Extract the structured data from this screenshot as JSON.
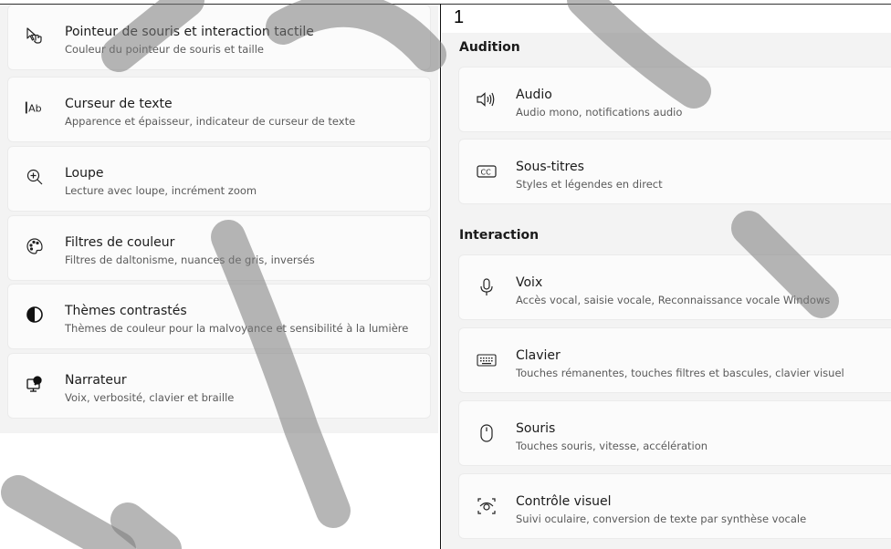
{
  "page_number": "1",
  "left_panel": {
    "items": [
      {
        "title": "Pointeur de souris et interaction tactile",
        "subtitle": "Couleur du pointeur de souris et taille",
        "icon": "mouse-pointer-touch-icon"
      },
      {
        "title": "Curseur de texte",
        "subtitle": "Apparence et épaisseur, indicateur de curseur de texte",
        "icon": "text-cursor-icon"
      },
      {
        "title": "Loupe",
        "subtitle": "Lecture avec loupe, incrément zoom",
        "icon": "magnifier-icon"
      },
      {
        "title": "Filtres de couleur",
        "subtitle": "Filtres de daltonisme, nuances de gris, inversés",
        "icon": "color-palette-icon"
      },
      {
        "title": "Thèmes contrastés",
        "subtitle": "Thèmes de couleur pour la malvoyance et sensibilité à la lumière",
        "icon": "contrast-icon"
      },
      {
        "title": "Narrateur",
        "subtitle": "Voix, verbosité, clavier et braille",
        "icon": "narrator-icon"
      }
    ]
  },
  "right_panel": {
    "sections": [
      {
        "heading": "Audition",
        "items": [
          {
            "title": "Audio",
            "subtitle": "Audio mono, notifications audio",
            "icon": "speaker-icon"
          },
          {
            "title": "Sous-titres",
            "subtitle": "Styles et légendes en direct",
            "icon": "closed-captions-icon"
          }
        ]
      },
      {
        "heading": "Interaction",
        "items": [
          {
            "title": "Voix",
            "subtitle": "Accès vocal, saisie vocale, Reconnaissance vocale Windows",
            "icon": "microphone-icon"
          },
          {
            "title": "Clavier",
            "subtitle": "Touches rémanentes, touches filtres et bascules, clavier visuel",
            "icon": "keyboard-icon"
          },
          {
            "title": "Souris",
            "subtitle": "Touches souris, vitesse, accélération",
            "icon": "mouse-icon"
          },
          {
            "title": "Contrôle visuel",
            "subtitle": "Suivi oculaire, conversion de texte par synthèse vocale",
            "icon": "eye-control-icon"
          }
        ]
      }
    ]
  }
}
